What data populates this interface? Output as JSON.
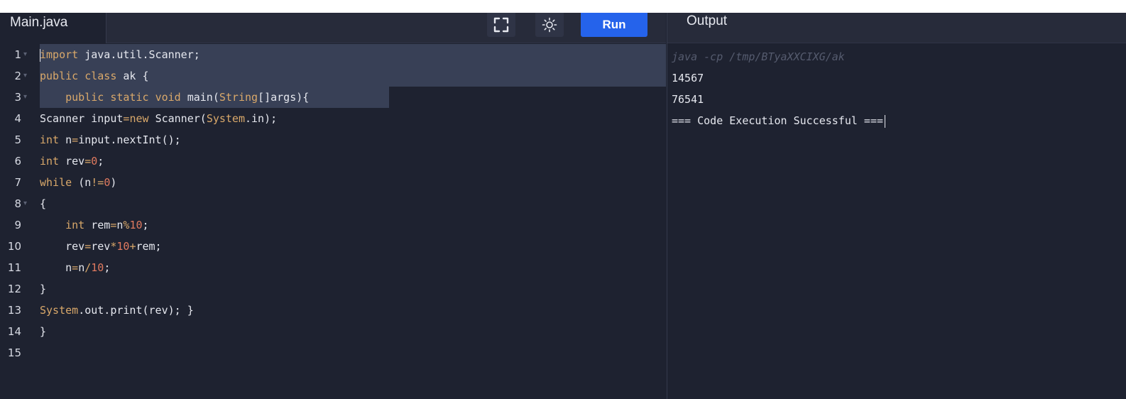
{
  "editor": {
    "file_name": "Main.java",
    "run_label": "Run",
    "fullscreen_icon": "fullscreen-icon",
    "theme_icon": "sun-icon",
    "lines": [
      {
        "n": "1",
        "fold": true,
        "code": [
          [
            "kw",
            "import"
          ],
          [
            "",
            "java.util.Scanner;"
          ]
        ]
      },
      {
        "n": "2",
        "fold": true,
        "code": [
          [
            "kw",
            "public"
          ],
          [
            "kw",
            "class"
          ],
          [
            "",
            "ak {"
          ]
        ]
      },
      {
        "n": "3",
        "fold": true,
        "code": [
          [
            "",
            "    "
          ],
          [
            "kw",
            "public"
          ],
          [
            "kw",
            "static"
          ],
          [
            "kw",
            "void"
          ],
          [
            "",
            "main("
          ],
          [
            "ty",
            "String"
          ],
          [
            "",
            "[]args){"
          ]
        ]
      },
      {
        "n": "4",
        "fold": false,
        "code": [
          [
            "",
            "Scanner input"
          ],
          [
            "op",
            "="
          ],
          [
            "kw",
            "new"
          ],
          [
            "",
            "Scanner("
          ],
          [
            "ty",
            "System"
          ],
          [
            "",
            ".in);"
          ]
        ]
      },
      {
        "n": "5",
        "fold": false,
        "code": [
          [
            "kw",
            "int"
          ],
          [
            "",
            "n"
          ],
          [
            "op",
            "="
          ],
          [
            "",
            "input.nextInt();"
          ]
        ]
      },
      {
        "n": "6",
        "fold": false,
        "code": [
          [
            "kw",
            "int"
          ],
          [
            "",
            "rev"
          ],
          [
            "op",
            "="
          ],
          [
            "num",
            "0"
          ],
          [
            "",
            ";"
          ]
        ]
      },
      {
        "n": "7",
        "fold": false,
        "code": [
          [
            "kw",
            "while"
          ],
          [
            "",
            "(n"
          ],
          [
            "op",
            "!="
          ],
          [
            "num",
            "0"
          ],
          [
            "",
            ")"
          ]
        ]
      },
      {
        "n": "8",
        "fold": true,
        "code": [
          [
            "",
            "{"
          ]
        ]
      },
      {
        "n": "9",
        "fold": false,
        "code": [
          [
            "",
            "    "
          ],
          [
            "kw",
            "int"
          ],
          [
            "",
            "rem"
          ],
          [
            "op",
            "="
          ],
          [
            "",
            "n"
          ],
          [
            "op",
            "%"
          ],
          [
            "num",
            "10"
          ],
          [
            "",
            ";"
          ]
        ]
      },
      {
        "n": "10",
        "fold": false,
        "code": [
          [
            "",
            "    rev"
          ],
          [
            "op",
            "="
          ],
          [
            "",
            "rev"
          ],
          [
            "op",
            "*"
          ],
          [
            "num",
            "10"
          ],
          [
            "op",
            "+"
          ],
          [
            "",
            "rem;"
          ]
        ]
      },
      {
        "n": "11",
        "fold": false,
        "code": [
          [
            "",
            "    n"
          ],
          [
            "op",
            "="
          ],
          [
            "",
            "n"
          ],
          [
            "op",
            "/"
          ],
          [
            "num",
            "10"
          ],
          [
            "",
            ";"
          ]
        ]
      },
      {
        "n": "12",
        "fold": false,
        "code": [
          [
            "",
            "}"
          ]
        ]
      },
      {
        "n": "13",
        "fold": false,
        "code": [
          [
            "ty",
            "System"
          ],
          [
            "",
            ".out.print(rev); }"
          ]
        ]
      },
      {
        "n": "14",
        "fold": false,
        "code": [
          [
            "",
            "}"
          ]
        ]
      },
      {
        "n": "15",
        "fold": false,
        "code": []
      }
    ]
  },
  "output": {
    "title": "Output",
    "command": "java -cp /tmp/BTyaXXCIXG/ak",
    "lines": [
      "14567",
      "76541",
      "=== Code Execution Successful ==="
    ]
  },
  "colors": {
    "run_button": "#2563eb",
    "background": "#1e2230",
    "keyword": "#d9a86a",
    "number": "#e07a5f"
  }
}
